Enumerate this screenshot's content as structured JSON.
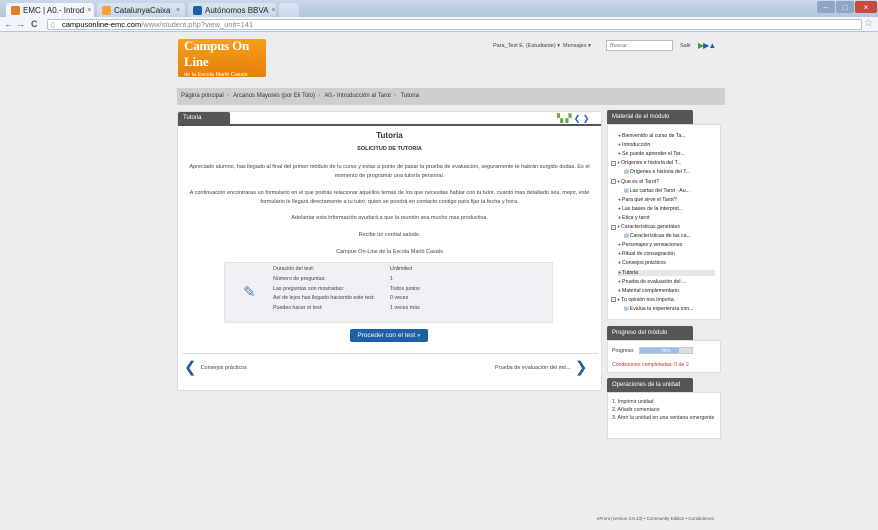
{
  "browser": {
    "tabs": [
      {
        "title": "EMC | A0.- Introd",
        "color": "#e67e22"
      },
      {
        "title": "CatalunyaCaixa",
        "color": "#f0a23a"
      },
      {
        "title": "Autónomos BBVA",
        "color": "#1f5fa8"
      }
    ],
    "url_host": "campusonline-emc.com",
    "url_path": "/www/student.php?view_unit=141",
    "nav": {
      "back": "←",
      "forward": "→",
      "reload": "C"
    }
  },
  "header": {
    "logo_line1_a": "Campus",
    "logo_line1_b": "On Line",
    "logo_line2": "de la Escola Marlò Casals",
    "user": "Para_Test E. (Estudiante) ▾",
    "messages": "Mensajes ▾",
    "search_placeholder": "Buscar",
    "logout": "Salir"
  },
  "breadcrumb": [
    "Página principal",
    "Arcanos Mayores (por Eli Tolo)",
    "A0.- Introducción al Tarot",
    "Tutoria"
  ],
  "main": {
    "tab_label": "Tutoria",
    "title": "Tutoria",
    "subtitle": "SOLICITUD DE TUTORIA",
    "p1": "Apreciado alumno, has llegado al final del primer módulo de tu curso y estas a punto de pasar la prueba de evaluación, seguramente te habrán surgido dudas. Es el momento de programar una tutoría personal.",
    "p2": "A continuación encontraras un formulario en el que podrás relacionar aquellos temas de los que necesitas hablar con tu tutor, cuanto mas detallado sea, mejor, este formulario le llegará directamente a tu tutor, quien se pondrá en contacto contigo para fijar la fecha y hora.",
    "p3": "Adelantar esta información ayudará a que la reunión sea mucho mas productiva.",
    "p4": "Recibe un cordial saludo.",
    "p5": "Campus On-Line de la Escola Marlò Casals",
    "info_rows": [
      {
        "label": "Duración del test:",
        "value": "Unlimited"
      },
      {
        "label": "Número de preguntas:",
        "value": "1"
      },
      {
        "label": "Las preguntas son mostradas:",
        "value": "Todos juntos"
      },
      {
        "label": "Así de lejos has llegado haciendo este test:",
        "value": "0 veces"
      },
      {
        "label": "Puedes hacer el test:",
        "value": "1 veces más"
      }
    ],
    "proceed_button": "Proceder con el test »",
    "prev_link": "Consejos prácticos",
    "next_link": "Prueba de evaluación del mó..."
  },
  "sidebar": {
    "material_title": "Material de el módulo",
    "tree": [
      {
        "label": "Bienvenido al curso de Ta...",
        "level": 1,
        "exp": false
      },
      {
        "label": "Introducción",
        "level": 1,
        "exp": false
      },
      {
        "label": "Se puede aprender el Tar...",
        "level": 1,
        "exp": false
      },
      {
        "label": "Orígenes e historia del T...",
        "level": 0,
        "exp": true
      },
      {
        "label": "Orígenes e historia del T...",
        "level": 2,
        "exp": false
      },
      {
        "label": "Que es el Tarot?",
        "level": 0,
        "exp": true
      },
      {
        "label": "Las cartas del Tarot - Au...",
        "level": 2,
        "exp": false
      },
      {
        "label": "Para qué sirve el Tarot?",
        "level": 1,
        "exp": false
      },
      {
        "label": "Las bases de la interpret...",
        "level": 1,
        "exp": false
      },
      {
        "label": "Ética y tarot",
        "level": 1,
        "exp": false
      },
      {
        "label": "Características generales",
        "level": 0,
        "exp": true
      },
      {
        "label": "Características de las ca...",
        "level": 2,
        "exp": false
      },
      {
        "label": "Personajes y sensaciones",
        "level": 1,
        "exp": false
      },
      {
        "label": "Ritual de consagración",
        "level": 1,
        "exp": false
      },
      {
        "label": "Consejos prácticos",
        "level": 1,
        "exp": false
      },
      {
        "label": "Tutoria",
        "level": 1,
        "exp": false,
        "current": true
      },
      {
        "label": "Prueba de evaluación del ...",
        "level": 1,
        "exp": false
      },
      {
        "label": "Material complementario.",
        "level": 1,
        "exp": false
      },
      {
        "label": "Tu opinión nos importa.",
        "level": 0,
        "exp": true
      },
      {
        "label": "Evalúa tu experiencia con...",
        "level": 2,
        "exp": false
      }
    ],
    "progress_title": "Progreso del módulo",
    "progress_label": "Progreso:",
    "progress_value": 0.75,
    "progress_text": "75%",
    "progress_conditions": "Condiciones completadas: 0 de 2",
    "ops_title": "Operaciones de la unidad",
    "ops": [
      "1. Imprimir unidad",
      "2. Añadir comentario",
      "3. Abrir la unidad en una ventana emergente"
    ]
  },
  "footer": "eFront (version 3.6.13) • Community Edition • Contáctenos"
}
